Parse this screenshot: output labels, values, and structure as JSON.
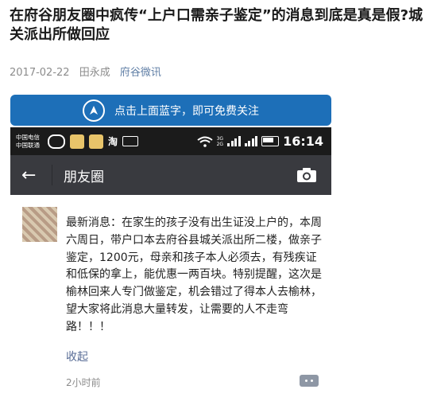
{
  "article": {
    "title": "在府谷朋友圈中疯传“上户口需亲子鉴定”的消息到底是真是假?城关派出所做回应",
    "date": "2017-02-22",
    "author": "田永成",
    "account": "府谷微讯"
  },
  "banner": {
    "text": "点击上面蓝字，即可免费关注"
  },
  "statusbar": {
    "carrier_line1": "中国电信",
    "carrier_line2": "中国联通",
    "tao": "淘",
    "net_line1": "3G",
    "net_line2": "2G",
    "time": "16:14"
  },
  "wechat": {
    "back": "←",
    "title": "朋友圈"
  },
  "post": {
    "text": "最新消息：在家生的孩子没有出生证没上户的，本周六周日，带户口本去府谷县城关派出所二楼，做亲子鉴定，1200元，母亲和孩子本人必须去，有残疾证和低保的拿上，能优惠一两百块。特别提醒，这次是榆林回来人专门做鉴定，机会错过了得本人去榆林，望大家将此消息大量转发，让需要的人不走弯路！！！",
    "collapse": "收起",
    "time": "2小时前"
  }
}
